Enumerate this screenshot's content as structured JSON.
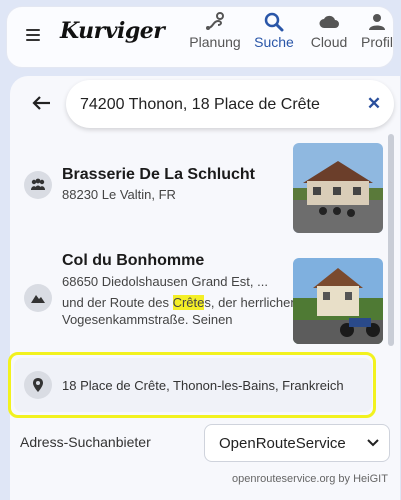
{
  "app": {
    "logo": "Kurviger"
  },
  "nav": [
    {
      "label": "Planung",
      "icon": "route-icon"
    },
    {
      "label": "Suche",
      "icon": "search-icon",
      "active": true
    },
    {
      "label": "Cloud",
      "icon": "cloud-icon"
    },
    {
      "label": "Profil",
      "icon": "person-icon"
    }
  ],
  "search": {
    "value": "74200 Thonon, 18 Place de Crête"
  },
  "results": [
    {
      "title": "Brasserie De La Schlucht",
      "subtitle": "88230 Le Valtin, FR",
      "icon": "group-icon"
    },
    {
      "title": "Col du Bonhomme",
      "subtitle": "68650 Diedolshausen Grand Est, ...",
      "desc_pre": "und der Route des ",
      "desc_highlight": "Crête",
      "desc_post": "s, der herrlichen Vogesenkammstraße. Seinen",
      "icon": "mountain-icon"
    }
  ],
  "address_result": {
    "text": "18 Place de Crête, Thonon-les-Bains, Frankreich",
    "icon": "location-pin-icon"
  },
  "provider": {
    "label": "Adress-Suchanbieter",
    "selected": "OpenRouteService"
  },
  "attribution": "openrouteservice.org by HeiGIT",
  "colors": {
    "accent": "#2a56a8",
    "highlight": "#f4ef27",
    "frame": "#f2f21e"
  }
}
